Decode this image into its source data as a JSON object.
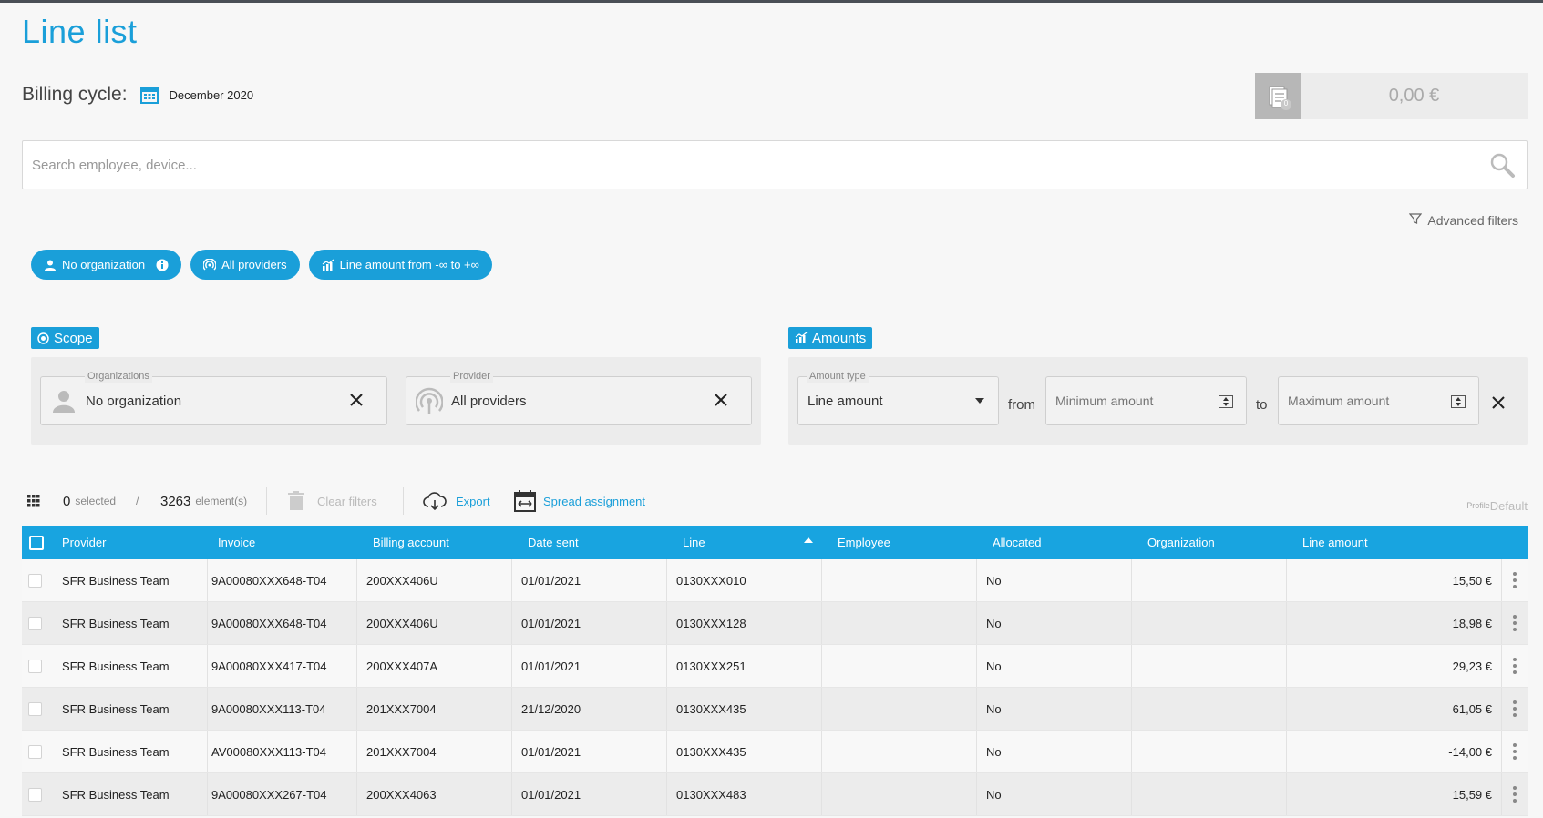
{
  "page": {
    "title": "Line list"
  },
  "billing": {
    "label": "Billing cycle:",
    "value": "December 2020"
  },
  "total": {
    "amount": "0,00 €",
    "badge": "0"
  },
  "search": {
    "placeholder": "Search employee, device..."
  },
  "advanced_filters": {
    "label": "Advanced filters"
  },
  "chips": [
    {
      "label": "No organization"
    },
    {
      "label": "All providers"
    },
    {
      "label": "Line amount from  -∞  to  +∞"
    }
  ],
  "scope": {
    "title": "Scope",
    "organizations": {
      "legend": "Organizations",
      "value": "No organization"
    },
    "provider": {
      "legend": "Provider",
      "value": "All providers"
    }
  },
  "amounts": {
    "title": "Amounts",
    "amount_type": {
      "legend": "Amount type",
      "value": "Line amount"
    },
    "from_label": "from",
    "min_placeholder": "Minimum amount",
    "to_label": "to",
    "max_placeholder": "Maximum amount"
  },
  "toolbar": {
    "selected_count": "0",
    "selected_label": "selected",
    "divider": "/",
    "elements_count": "3263",
    "elements_label": "element(s)",
    "clear_filters": "Clear filters",
    "export": "Export",
    "spread_assignment": "Spread assignment",
    "profile_label": "Profile",
    "profile_value": "Default"
  },
  "table": {
    "columns": [
      "Provider",
      "Invoice",
      "Billing account",
      "Date sent",
      "Line",
      "Employee",
      "Allocated",
      "Organization",
      "Line amount"
    ],
    "rows": [
      {
        "provider": "SFR Business Team",
        "invoice": "9A00080XXX648-T04",
        "account": "200XXX406U",
        "date": "01/01/2021",
        "line": "0130XXX010",
        "employee": "",
        "allocated": "No",
        "organization": "",
        "amount": "15,50 €"
      },
      {
        "provider": "SFR Business Team",
        "invoice": "9A00080XXX648-T04",
        "account": "200XXX406U",
        "date": "01/01/2021",
        "line": "0130XXX128",
        "employee": "",
        "allocated": "No",
        "organization": "",
        "amount": "18,98 €"
      },
      {
        "provider": "SFR Business Team",
        "invoice": "9A00080XXX417-T04",
        "account": "200XXX407A",
        "date": "01/01/2021",
        "line": "0130XXX251",
        "employee": "",
        "allocated": "No",
        "organization": "",
        "amount": "29,23 €"
      },
      {
        "provider": "SFR Business Team",
        "invoice": "9A00080XXX113-T04",
        "account": "201XXX7004",
        "date": "21/12/2020",
        "line": "0130XXX435",
        "employee": "",
        "allocated": "No",
        "organization": "",
        "amount": "61,05 €"
      },
      {
        "provider": "SFR Business Team",
        "invoice": "AV00080XXX113-T04",
        "account": "201XXX7004",
        "date": "01/01/2021",
        "line": "0130XXX435",
        "employee": "",
        "allocated": "No",
        "organization": "",
        "amount": "-14,00 €"
      },
      {
        "provider": "SFR Business Team",
        "invoice": "9A00080XXX267-T04",
        "account": "200XXX4063",
        "date": "01/01/2021",
        "line": "0130XXX483",
        "employee": "",
        "allocated": "No",
        "organization": "",
        "amount": "15,59 €"
      }
    ]
  },
  "colors": {
    "accent": "#1a9fd9",
    "header": "#18a4e0"
  }
}
